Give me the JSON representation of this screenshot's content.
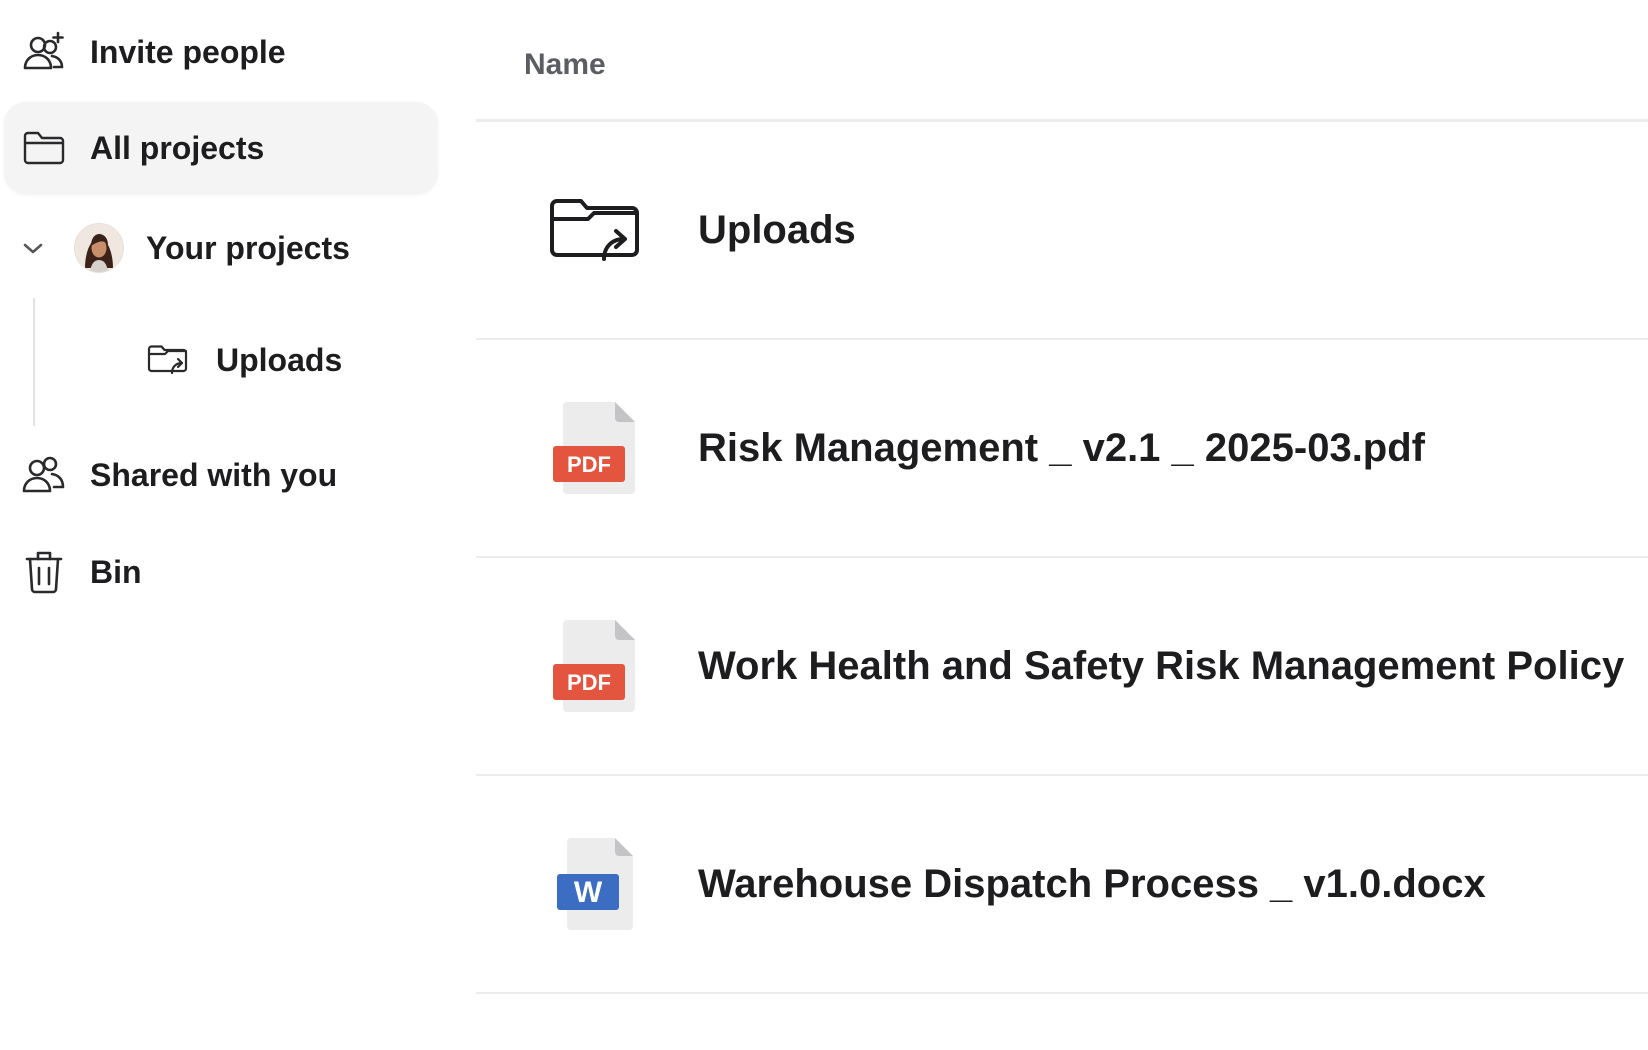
{
  "sidebar": {
    "invite_label": "Invite people",
    "all_projects_label": "All projects",
    "your_projects_label": "Your projects",
    "uploads_label": "Uploads",
    "shared_label": "Shared with you",
    "bin_label": "Bin",
    "icons": {
      "invite": "add-user-icon",
      "all_projects": "folder-icon",
      "your_projects_toggle": "chevron-down-icon",
      "uploads": "folder-upload-icon",
      "shared": "users-icon",
      "bin": "trash-icon"
    }
  },
  "list": {
    "column_name": "Name",
    "rows": [
      {
        "name": "Uploads",
        "type": "folder-upload",
        "badge": ""
      },
      {
        "name": "Risk Management _ v2.1 _ 2025-03.pdf",
        "type": "pdf",
        "badge": "PDF"
      },
      {
        "name": "Work Health and Safety Risk Management Policy",
        "type": "pdf",
        "badge": "PDF"
      },
      {
        "name": "Warehouse Dispatch Process _ v1.0.docx",
        "type": "word",
        "badge": "W"
      }
    ]
  },
  "colors": {
    "pdf_badge": "#e4553f",
    "word_badge": "#3b6ec2",
    "active_bg": "#f4f4f5",
    "divider": "#ececee"
  }
}
